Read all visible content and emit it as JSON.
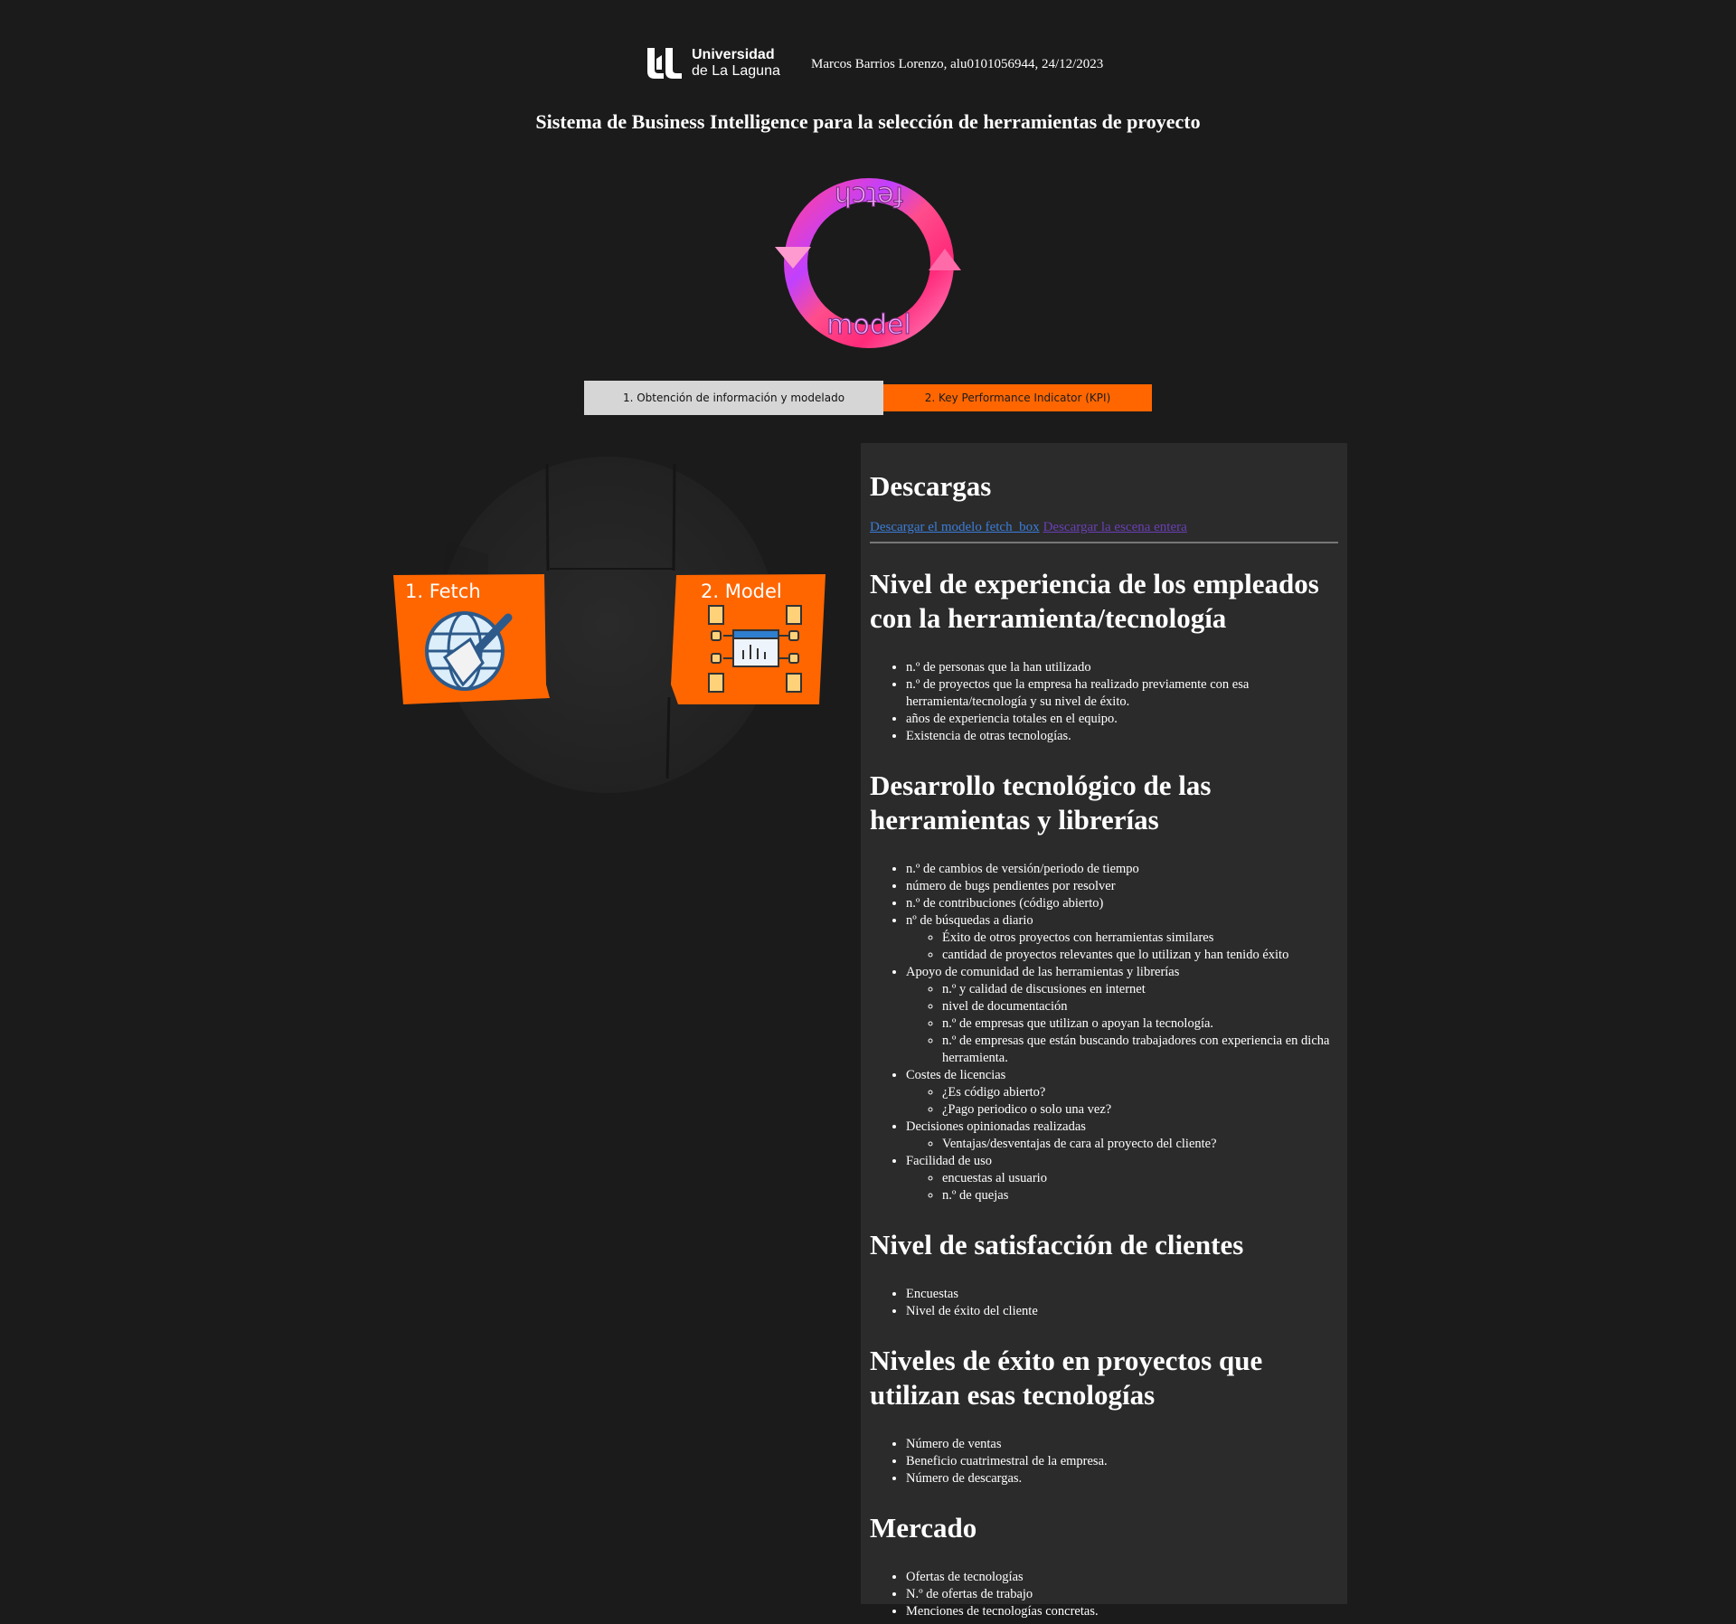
{
  "header": {
    "logo_line1": "Universidad",
    "logo_line2": "de La Laguna",
    "author": "Marcos Barrios Lorenzo, alu0101056944, 24/12/2023"
  },
  "title": "Sistema de Business Intelligence para la selección de herramientas de proyecto",
  "cycle_graphic": {
    "top_word": "fetch",
    "bottom_word": "model"
  },
  "tabs": [
    {
      "label": "1. Obtención de información y modelado",
      "color": "#d6d6d6"
    },
    {
      "label": "2. Key Performance Indicator (KPI)",
      "color": "#ff6600"
    }
  ],
  "scene": {
    "card1_label": "1. Fetch",
    "card2_label": "2. Model",
    "card_color": "#ff6600",
    "card1_icon": "globe-broom-icon",
    "card2_icon": "data-model-icon"
  },
  "panel": {
    "downloads_title": "Descargas",
    "link1": "Descargar el modelo fetch_box",
    "link2": "Descargar la escena entera",
    "sections": [
      {
        "title": "Nivel de experiencia de los empleados con la herramienta/tecnología",
        "items": [
          {
            "text": "n.º de personas que la han utilizado"
          },
          {
            "text": "n.º de proyectos que la empresa ha realizado previamente con esa herramienta/tecnología y su nivel de éxito."
          },
          {
            "text": "años de experiencia totales en el equipo."
          },
          {
            "text": "Existencia de otras tecnologías."
          }
        ]
      },
      {
        "title": "Desarrollo tecnológico de las herramientas y librerías",
        "items": [
          {
            "text": "n.º de cambios de versión/periodo de tiempo"
          },
          {
            "text": "número de bugs pendientes por resolver"
          },
          {
            "text": "n.º de contribuciones (código abierto)"
          },
          {
            "text": "nº de búsquedas a diario",
            "sub": [
              "Éxito de otros proyectos con herramientas similares",
              "cantidad de proyectos relevantes que lo utilizan y han tenido éxito"
            ]
          },
          {
            "text": "Apoyo de comunidad de las herramientas y librerías",
            "sub": [
              "n.º y calidad de discusiones en internet",
              "nivel de documentación",
              "n.º de empresas que utilizan o apoyan la tecnología.",
              "n.º de empresas que están buscando trabajadores con experiencia en dicha herramienta."
            ]
          },
          {
            "text": "Costes de licencias",
            "sub": [
              "¿Es código abierto?",
              "¿Pago periodico o solo una vez?"
            ]
          },
          {
            "text": "Decisiones opinionadas realizadas",
            "sub": [
              "Ventajas/desventajas de cara al proyecto del cliente?"
            ]
          },
          {
            "text": "Facilidad de uso",
            "sub": [
              "encuestas al usuario",
              "n.º de quejas"
            ]
          }
        ]
      },
      {
        "title": "Nivel de satisfacción de clientes",
        "items": [
          {
            "text": "Encuestas"
          },
          {
            "text": "Nivel de éxito del cliente"
          }
        ]
      },
      {
        "title": "Niveles de éxito en proyectos que utilizan esas tecnologías",
        "items": [
          {
            "text": "Número de ventas"
          },
          {
            "text": "Beneficio cuatrimestral de la empresa."
          },
          {
            "text": "Número de descargas."
          }
        ]
      },
      {
        "title": "Mercado",
        "items": [
          {
            "text": "Ofertas de tecnologías"
          },
          {
            "text": "N.º de ofertas de trabajo"
          },
          {
            "text": "Menciones de tecnologías concretas."
          }
        ]
      }
    ]
  }
}
